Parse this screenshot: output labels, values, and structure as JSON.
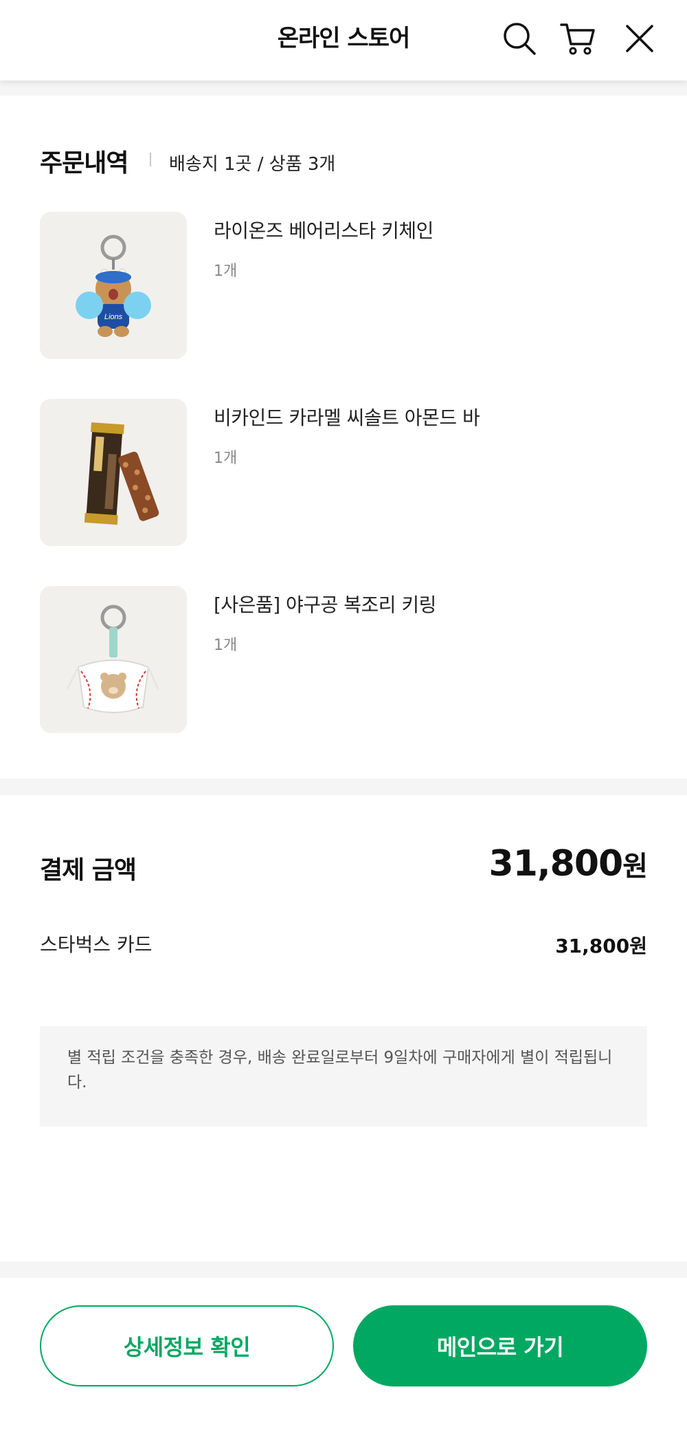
{
  "header": {
    "title": "온라인 스토어",
    "icons": [
      "search-icon",
      "cart-icon",
      "close-icon"
    ]
  },
  "order": {
    "title": "주문내역",
    "meta": "배송지 1곳 / 상품 3개",
    "items": [
      {
        "name": "라이온즈 베어리스타 키체인",
        "qty": "1개",
        "image": "bear-keychain-image"
      },
      {
        "name": "비카인드 카라멜 씨솔트 아몬드 바",
        "qty": "1개",
        "image": "almond-bar-image"
      },
      {
        "name": "[사은품] 야구공 복조리 키링",
        "qty": "1개",
        "image": "baseball-pouch-keyring-image"
      }
    ]
  },
  "payment": {
    "title": "결제 금액",
    "total_amount": "31,800",
    "total_unit": "원",
    "method": "스타벅스 카드",
    "method_amount": "31,800원"
  },
  "notice": "별 적립 조건을 충족한 경우, 배송 완료일로부터 9일차에 구매자에게 별이 적립됩니다.",
  "buttons": {
    "detail": "상세정보 확인",
    "main": "메인으로 가기"
  },
  "colors": {
    "accent": "#00a862",
    "thumb_bg": "#f1f0ec",
    "band": "#f5f5f5"
  }
}
